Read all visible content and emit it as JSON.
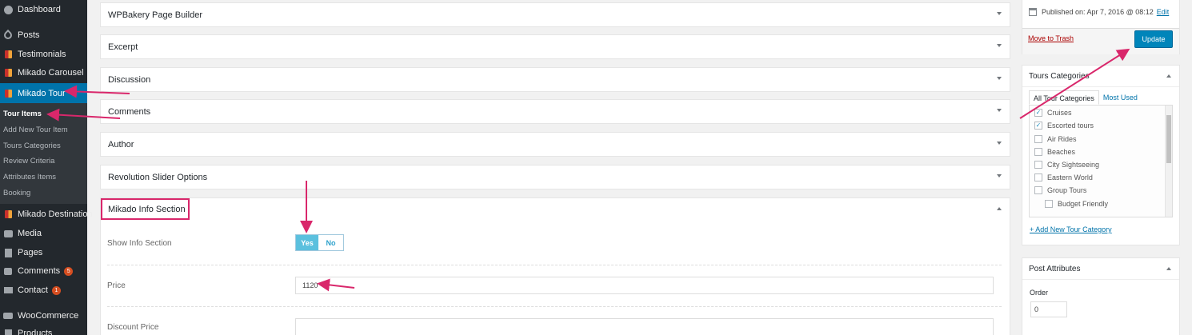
{
  "sidebar": {
    "items": [
      {
        "label": "Dashboard",
        "icon": "dashboard-icon"
      },
      {
        "label": "Posts",
        "icon": "pin-icon"
      },
      {
        "label": "Testimonials",
        "icon": "mikado-icon"
      },
      {
        "label": "Mikado Carousel",
        "icon": "mikado-icon"
      },
      {
        "label": "Mikado Tour",
        "icon": "mikado-icon"
      },
      {
        "label": "Mikado Destination",
        "icon": "mikado-icon"
      },
      {
        "label": "Media",
        "icon": "media-icon"
      },
      {
        "label": "Pages",
        "icon": "pages-icon"
      },
      {
        "label": "Comments",
        "icon": "comments-icon",
        "badge": "5"
      },
      {
        "label": "Contact",
        "icon": "mail-icon",
        "badge": "1"
      },
      {
        "label": "WooCommerce",
        "icon": "woo-icon"
      },
      {
        "label": "Products",
        "icon": "product-icon"
      }
    ],
    "submenu": [
      "Tour Items",
      "Add New Tour Item",
      "Tours Categories",
      "Review Criteria",
      "Attributes Items",
      "Booking"
    ]
  },
  "metaboxes": [
    "WPBakery Page Builder",
    "Excerpt",
    "Discussion",
    "Comments",
    "Author",
    "Revolution Slider Options"
  ],
  "info_section": {
    "title": "Mikado Info Section",
    "show_label": "Show Info Section",
    "yes": "Yes",
    "no": "No",
    "price_label": "Price",
    "price_value": "1120",
    "discount_label": "Discount Price",
    "discount_value": ""
  },
  "publish": {
    "published_on": "Published on: Apr 7, 2016 @ 08:12",
    "edit": "Edit",
    "trash": "Move to Trash",
    "update": "Update"
  },
  "categories": {
    "title": "Tours Categories",
    "tab_all": "All Tour Categories",
    "tab_most_used": "Most Used",
    "items": [
      {
        "label": "Cruises",
        "checked": true
      },
      {
        "label": "Escorted tours",
        "checked": true
      },
      {
        "label": "Air Rides",
        "checked": false
      },
      {
        "label": "Beaches",
        "checked": false
      },
      {
        "label": "City Sightseeing",
        "checked": false
      },
      {
        "label": "Eastern World",
        "checked": false
      },
      {
        "label": "Group Tours",
        "checked": false
      },
      {
        "label": "Budget Friendly",
        "checked": false
      }
    ],
    "add_new": "+ Add New Tour Category"
  },
  "attributes": {
    "title": "Post Attributes",
    "order_label": "Order",
    "order_value": "0"
  },
  "annotation_color": "#d9276b"
}
